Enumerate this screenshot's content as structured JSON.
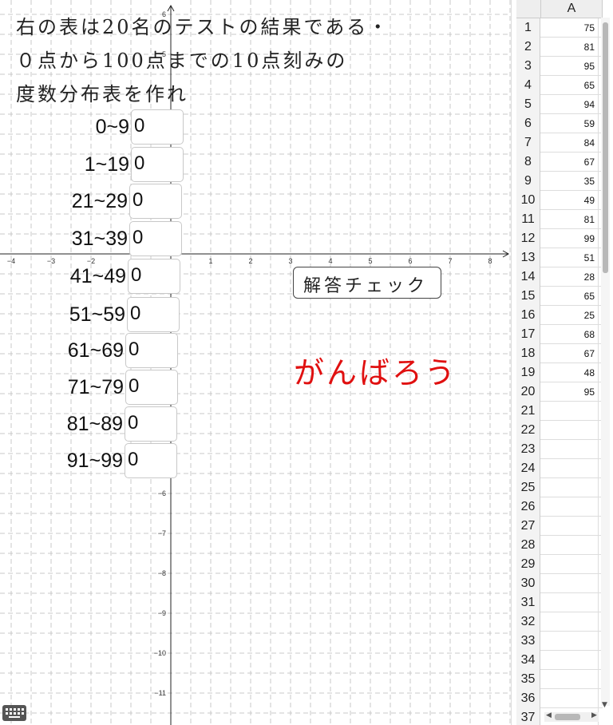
{
  "problem": {
    "line1": "右の表は20名のテストの結果である・",
    "line2": "０点から100点までの10点刻みの",
    "line3": "度数分布表を作れ"
  },
  "table_rows": [
    {
      "range": "0~9",
      "value": "0"
    },
    {
      "range": "1~19",
      "value": "0"
    },
    {
      "range": "21~29",
      "value": "0"
    },
    {
      "range": "31~39",
      "value": "0"
    },
    {
      "range": "41~49",
      "value": "0"
    },
    {
      "range": "51~59",
      "value": "0"
    },
    {
      "range": "61~69",
      "value": "0"
    },
    {
      "range": "71~79",
      "value": "0"
    },
    {
      "range": "81~89",
      "value": "0"
    },
    {
      "range": "91~99",
      "value": "0"
    }
  ],
  "check_button_label": "解答チェック",
  "cheer_text": "がんばろう",
  "cheer_color": "#e01010",
  "axes": {
    "x_ticks": [
      "−4",
      "−3",
      "−2",
      "1",
      "2",
      "3",
      "4",
      "5",
      "6",
      "7",
      "8"
    ],
    "y_ticks": [
      "6",
      "5",
      "−6",
      "−7",
      "−8",
      "−9",
      "−10",
      "−11"
    ]
  },
  "spreadsheet": {
    "column_header": "A",
    "rows": [
      {
        "row": "1",
        "value": "75"
      },
      {
        "row": "2",
        "value": "81"
      },
      {
        "row": "3",
        "value": "95"
      },
      {
        "row": "4",
        "value": "65"
      },
      {
        "row": "5",
        "value": "94"
      },
      {
        "row": "6",
        "value": "59"
      },
      {
        "row": "7",
        "value": "84"
      },
      {
        "row": "8",
        "value": "67"
      },
      {
        "row": "9",
        "value": "35"
      },
      {
        "row": "10",
        "value": "49"
      },
      {
        "row": "11",
        "value": "81"
      },
      {
        "row": "12",
        "value": "99"
      },
      {
        "row": "13",
        "value": "51"
      },
      {
        "row": "14",
        "value": "28"
      },
      {
        "row": "15",
        "value": "65"
      },
      {
        "row": "16",
        "value": "25"
      },
      {
        "row": "17",
        "value": "68"
      },
      {
        "row": "18",
        "value": "67"
      },
      {
        "row": "19",
        "value": "48"
      },
      {
        "row": "20",
        "value": "95"
      },
      {
        "row": "21",
        "value": ""
      },
      {
        "row": "22",
        "value": ""
      },
      {
        "row": "23",
        "value": ""
      },
      {
        "row": "24",
        "value": ""
      },
      {
        "row": "25",
        "value": ""
      },
      {
        "row": "26",
        "value": ""
      },
      {
        "row": "27",
        "value": ""
      },
      {
        "row": "28",
        "value": ""
      },
      {
        "row": "29",
        "value": ""
      },
      {
        "row": "30",
        "value": ""
      },
      {
        "row": "31",
        "value": ""
      },
      {
        "row": "32",
        "value": ""
      },
      {
        "row": "33",
        "value": ""
      },
      {
        "row": "34",
        "value": ""
      },
      {
        "row": "35",
        "value": ""
      },
      {
        "row": "36",
        "value": ""
      },
      {
        "row": "37",
        "value": ""
      }
    ]
  },
  "icons": {
    "keyboard": "keyboard-icon",
    "scroll_left": "arrow-left-icon",
    "scroll_right": "arrow-right-icon",
    "scroll_down": "arrow-down-icon"
  }
}
